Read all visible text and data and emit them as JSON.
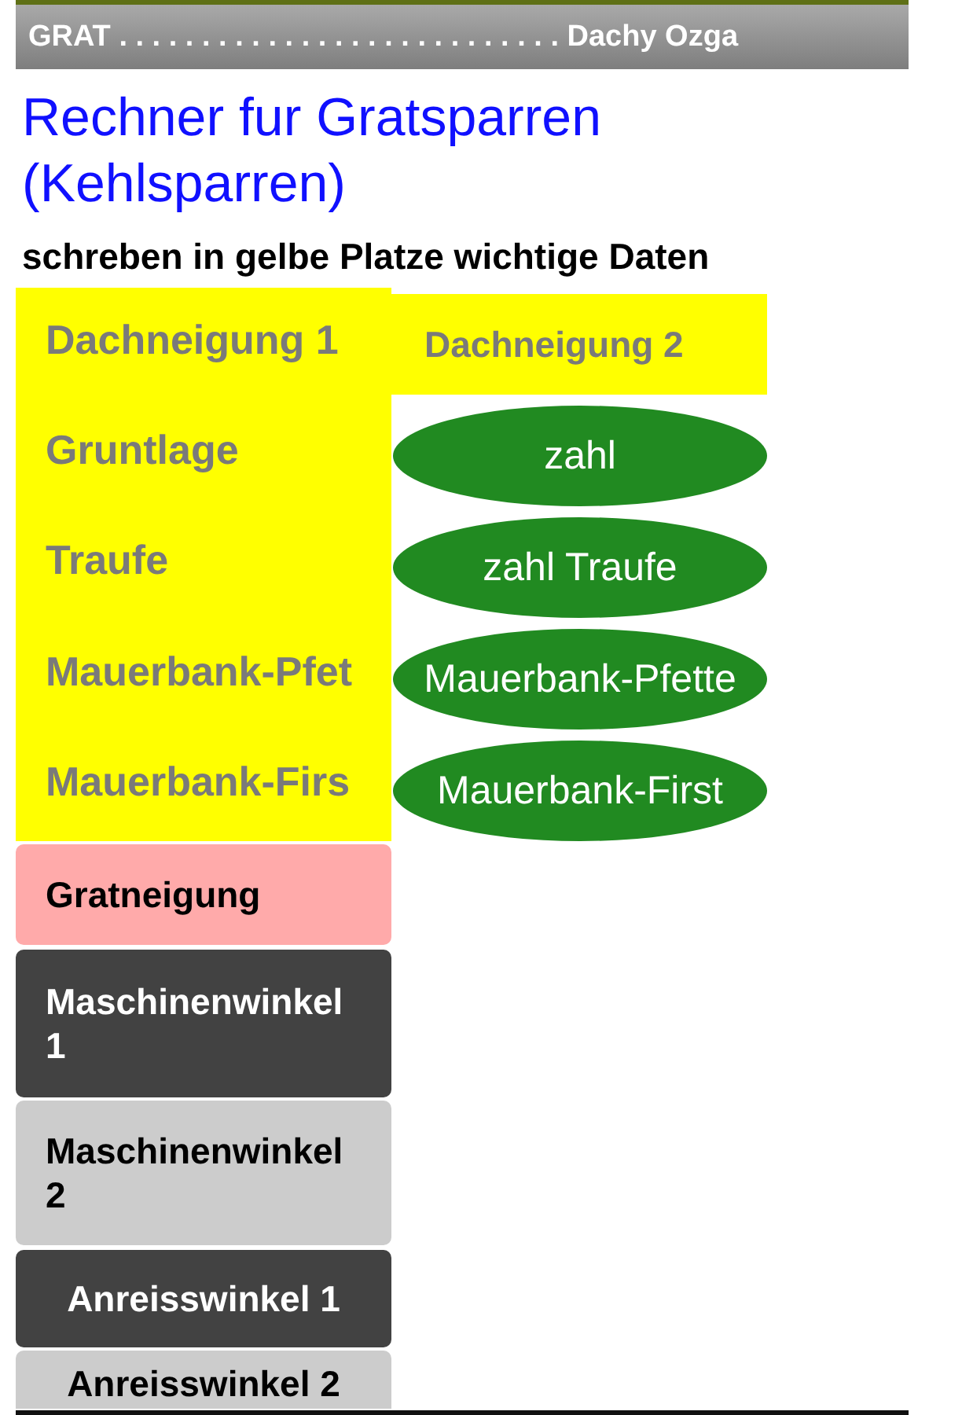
{
  "title_bar": {
    "title": "GRAT . . . . . . . . . . . . . . . . . . . . . . . . . . . Dachy Ozga"
  },
  "heading": "Rechner fur Gratsparren (Kehlsparren)",
  "instruction": "schreben in gelbe Platze wichtige Daten",
  "input_fields": [
    {
      "placeholder": "Dachneigung 1"
    },
    {
      "placeholder": "Gruntlage"
    },
    {
      "placeholder": "Traufe"
    },
    {
      "placeholder": "Mauerbank-Pfet"
    },
    {
      "placeholder": "Mauerbank-Firs"
    }
  ],
  "side_field": {
    "placeholder": "Dachneigung 2"
  },
  "result_buttons": [
    {
      "label": "zahl"
    },
    {
      "label": "zahl Traufe"
    },
    {
      "label": "Mauerbank-Pfette"
    },
    {
      "label": "Mauerbank-First"
    }
  ],
  "buttons": [
    {
      "label": "Gratneigung",
      "kind": "highlight"
    },
    {
      "label": "Maschinenwinkel 1",
      "kind": "dark"
    },
    {
      "label": "Maschinenwinkel 2",
      "kind": "light"
    },
    {
      "label": "Anreisswinkel 1",
      "kind": "dark"
    },
    {
      "label": "Anreisswinkel 2",
      "kind": "light"
    }
  ]
}
